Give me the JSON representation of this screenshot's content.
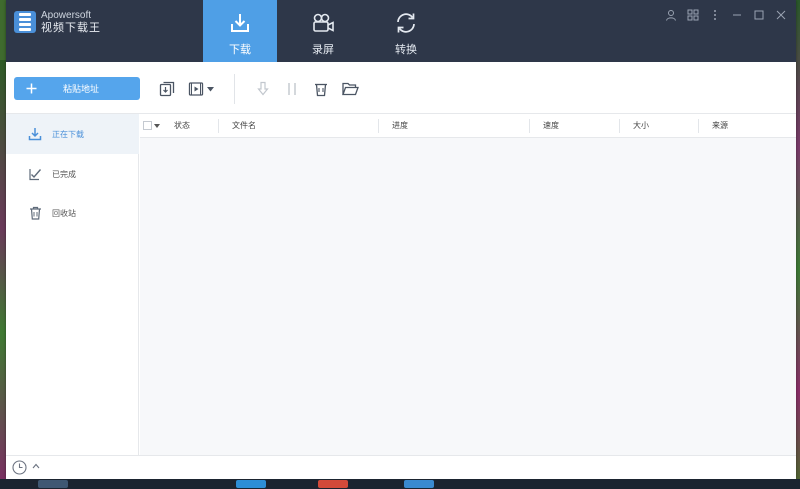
{
  "app": {
    "brand": "Apowersoft",
    "name": "视频下载王"
  },
  "nav_tabs": [
    {
      "label": "下载",
      "icon": "download-tray-icon",
      "active": true
    },
    {
      "label": "录屏",
      "icon": "video-camera-icon",
      "active": false
    },
    {
      "label": "转换",
      "icon": "convert-arrows-icon",
      "active": false
    }
  ],
  "window_controls": [
    "user-icon",
    "grid-settings-icon",
    "more-vertical-icon",
    "minimize-icon",
    "maximize-icon",
    "close-icon"
  ],
  "toolbar": {
    "paste_button": "粘贴地址",
    "icons": [
      "batch-download-icon",
      "video-download-icon",
      "dropdown-caret-icon",
      "start-download-icon",
      "pause-icon",
      "delete-icon",
      "open-folder-icon"
    ]
  },
  "sidebar": {
    "items": [
      {
        "label": "正在下载",
        "icon": "download-icon",
        "active": true
      },
      {
        "label": "已完成",
        "icon": "checklist-icon",
        "active": false
      },
      {
        "label": "回收站",
        "icon": "trash-icon",
        "active": false
      }
    ]
  },
  "table": {
    "columns": [
      "状态",
      "文件名",
      "进度",
      "速度",
      "大小",
      "来源"
    ],
    "rows": []
  },
  "colors": {
    "titlebar": "#2e3749",
    "accent": "#4f9fe6",
    "button": "#55a5ec",
    "sidebar_active_bg": "#eef3f8",
    "content_bg": "#f7f8fa"
  }
}
